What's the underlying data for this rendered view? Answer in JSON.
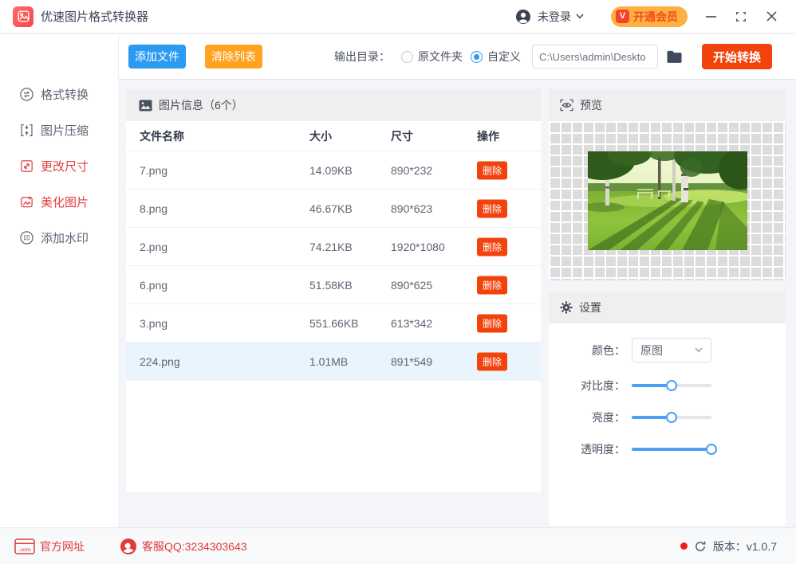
{
  "titlebar": {
    "app_title": "优速图片格式转换器",
    "login_label": "未登录",
    "vip_label": "开通会员",
    "vip_badge": "V"
  },
  "toolbar": {
    "add_files_label": "添加文件",
    "clear_list_label": "清除列表",
    "output_dir_label": "输出目录：",
    "radio_original_label": "原文件夹",
    "radio_custom_label": "自定义",
    "radio_selected": "自定义",
    "path_value": "C:\\Users\\admin\\Deskto",
    "start_convert_label": "开始转换"
  },
  "sidebar": {
    "items": [
      {
        "label": "格式转换",
        "icon": "convert-icon",
        "state": "default"
      },
      {
        "label": "图片压缩",
        "icon": "compress-icon",
        "state": "default"
      },
      {
        "label": "更改尺寸",
        "icon": "resize-icon",
        "state": "highlight"
      },
      {
        "label": "美化图片",
        "icon": "beautify-icon",
        "state": "highlight"
      },
      {
        "label": "添加水印",
        "icon": "watermark-icon",
        "state": "default"
      }
    ]
  },
  "file_table": {
    "section_title": "图片信息（6个）",
    "columns": [
      "文件名称",
      "大小",
      "尺寸",
      "操作"
    ],
    "delete_label": "删除",
    "selected_index": 5,
    "rows": [
      {
        "name": "7.png",
        "size": "14.09KB",
        "dimensions": "890*232"
      },
      {
        "name": "8.png",
        "size": "46.67KB",
        "dimensions": "890*623"
      },
      {
        "name": "2.png",
        "size": "74.21KB",
        "dimensions": "1920*1080"
      },
      {
        "name": "6.png",
        "size": "51.58KB",
        "dimensions": "890*625"
      },
      {
        "name": "3.png",
        "size": "551.66KB",
        "dimensions": "613*342"
      },
      {
        "name": "224.png",
        "size": "1.01MB",
        "dimensions": "891*549"
      }
    ]
  },
  "preview": {
    "title": "预览"
  },
  "settings": {
    "title": "设置",
    "color_label": "颜色：",
    "color_value": "原图",
    "sliders": [
      {
        "label": "对比度：",
        "percent": 50
      },
      {
        "label": "亮度：",
        "percent": 50
      },
      {
        "label": "透明度：",
        "percent": 100
      }
    ]
  },
  "footer": {
    "website_label": "官方网址",
    "qq_label": "客服QQ:3234303643",
    "version_label": "版本：v1.0.7"
  },
  "colors": {
    "accent_blue": "#2b9bf2",
    "accent_orange": "#ffa21f",
    "accent_red": "#f2430d",
    "brand_red": "#f84848",
    "vip_bg": "#ffb043",
    "vip_text": "#f04b1c",
    "sidebar_red": "#e23d3d",
    "footer_red": "#e13a3a",
    "selected_row_bg": "#e9f4fd",
    "slider_blue": "#4aa0f5"
  }
}
